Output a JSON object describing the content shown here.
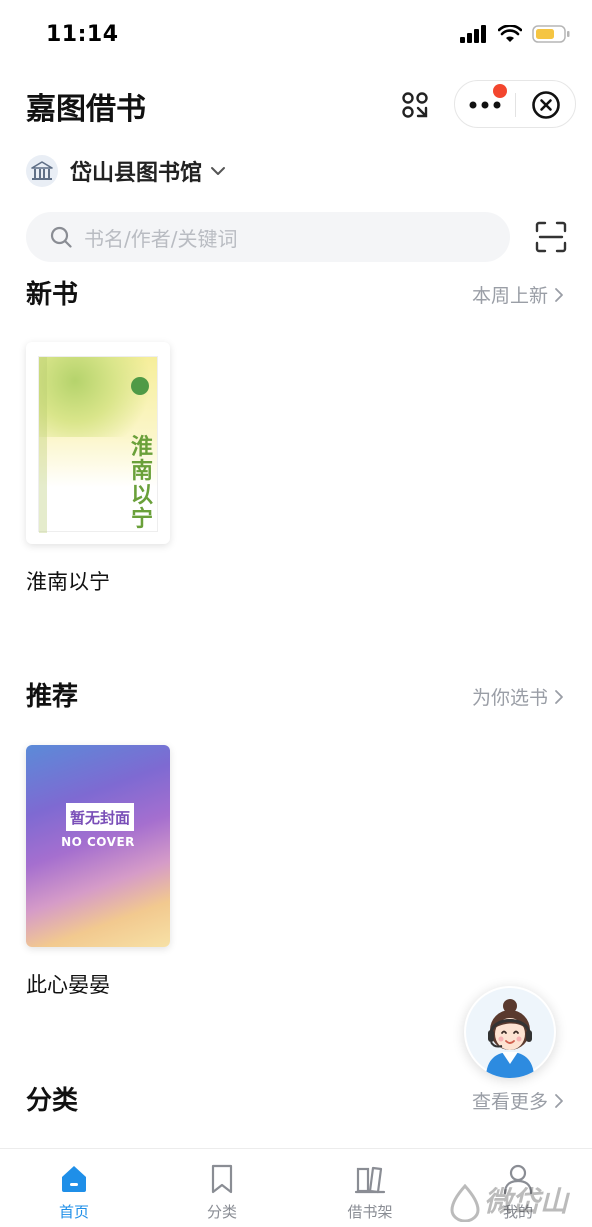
{
  "status_bar": {
    "time": "11:14",
    "battery_color": "#f5c542"
  },
  "header": {
    "title": "嘉图借书",
    "scan_icon": "scan-qr-icon",
    "more_icon": "more-dots-icon",
    "close_icon": "close-circle-icon"
  },
  "library": {
    "name": "岱山县图书馆",
    "icon": "library-building-icon"
  },
  "search": {
    "placeholder": "书名/作者/关键词",
    "scan_icon": "scan-code-icon"
  },
  "sections": {
    "new_books": {
      "title": "新书",
      "more_label": "本周上新",
      "books": [
        {
          "title": "淮南以宁",
          "cover_text": "淮南以宁"
        }
      ]
    },
    "recommend": {
      "title": "推荐",
      "more_label": "为你选书",
      "books": [
        {
          "title": "此心晏晏",
          "cover_text_cn": "暂无封面",
          "cover_text_en": "NO COVER"
        }
      ]
    },
    "categories": {
      "title": "分类",
      "more_label": "查看更多"
    }
  },
  "tabs": [
    {
      "label": "首页",
      "icon": "home-icon",
      "active": true
    },
    {
      "label": "分类",
      "icon": "bookmark-icon",
      "active": false
    },
    {
      "label": "借书架",
      "icon": "bookshelf-icon",
      "active": false
    },
    {
      "label": "我的",
      "icon": "user-icon",
      "active": false
    }
  ],
  "watermark": "微岱山",
  "colors": {
    "accent": "#1f8fe8",
    "notification_dot": "#f3462e",
    "muted_text": "#9a9ea6"
  }
}
